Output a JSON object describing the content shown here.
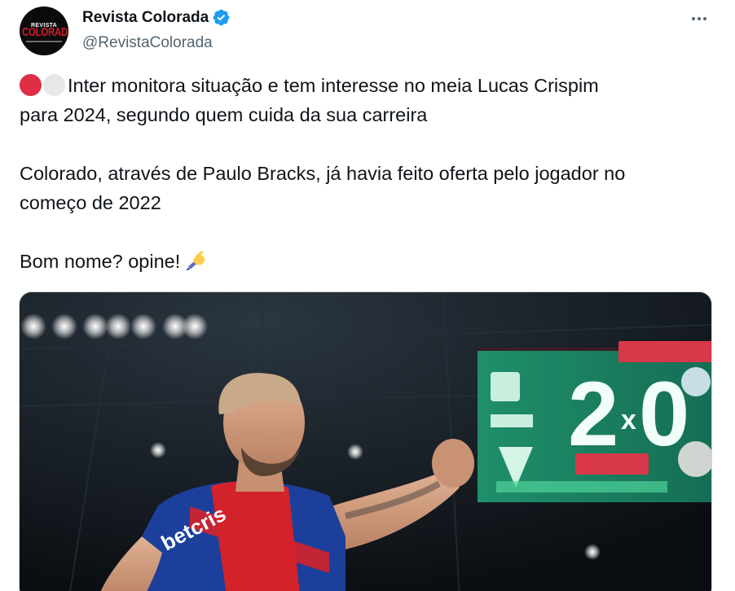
{
  "author": {
    "display_name": "Revista Colorada",
    "handle": "@RevistaColorada",
    "avatar_logo_top": "REVISTA",
    "avatar_logo_main": "COLORADA",
    "verified": true,
    "verified_color": "#1d9bf0"
  },
  "tweet": {
    "line1": "Inter monitora situação e tem interesse no meia Lucas Crispim",
    "line2": "para 2024, segundo quem cuida da sua carreira",
    "line3": "Colorado, através de Paulo Bracks, já havia feito oferta pelo jogador no",
    "line4": "começo de 2022",
    "line5": "Bom nome? opine!",
    "emoji_leading": [
      "red-circle",
      "white-circle"
    ],
    "emoji_trailing": "writing-hand"
  },
  "media": {
    "scoreboard_home": "2",
    "scoreboard_sep": "x",
    "scoreboard_away": "0",
    "jersey_sponsor": "betcris",
    "accent_colors": {
      "jersey_blue": "#1c3f9c",
      "jersey_red": "#d4222b",
      "scoreboard_green": "#1fa86a"
    }
  },
  "icons": {
    "more": "more-horizontal-icon",
    "verified": "verified-badge-icon"
  }
}
